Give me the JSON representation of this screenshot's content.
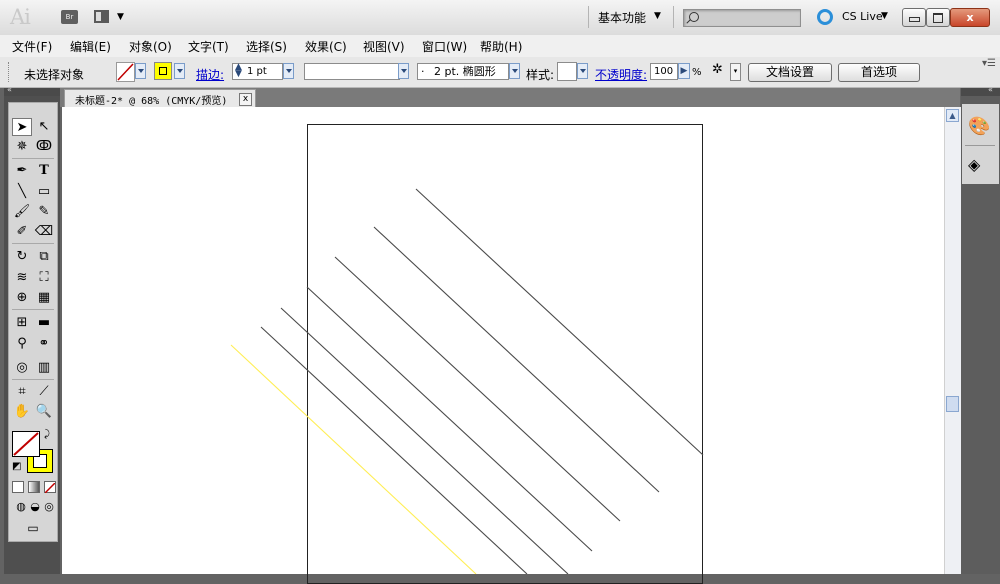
{
  "app": {
    "logo": "Ai",
    "bridge_label": "Br",
    "workspace": "基本功能",
    "search_placeholder": "",
    "cslive": "CS Live",
    "close": "x"
  },
  "menu": [
    "文件(F)",
    "编辑(E)",
    "对象(O)",
    "文字(T)",
    "选择(S)",
    "效果(C)",
    "视图(V)",
    "窗口(W)",
    "帮助(H)"
  ],
  "control": {
    "selection_status": "未选择对象",
    "stroke_label": "描边:",
    "stroke_weight": "1 pt",
    "brush": "2 pt. 椭圆形",
    "brush_dot": "·",
    "style_label": "样式:",
    "opacity_label": "不透明度:",
    "opacity_value": "100",
    "opacity_unit": "%",
    "doc_setup": "文档设置",
    "prefs": "首选项",
    "fill_color": "#ffffff",
    "stroke_color": "#c00000",
    "stroke_swatch_color": "#ffff00"
  },
  "document": {
    "tab_label": "未标题-2* @ 68% (CMYK/预览)",
    "tab_close": "x"
  },
  "colors": {
    "line_gray": "#4a4a4a",
    "line_yellow": "#ffee55"
  }
}
